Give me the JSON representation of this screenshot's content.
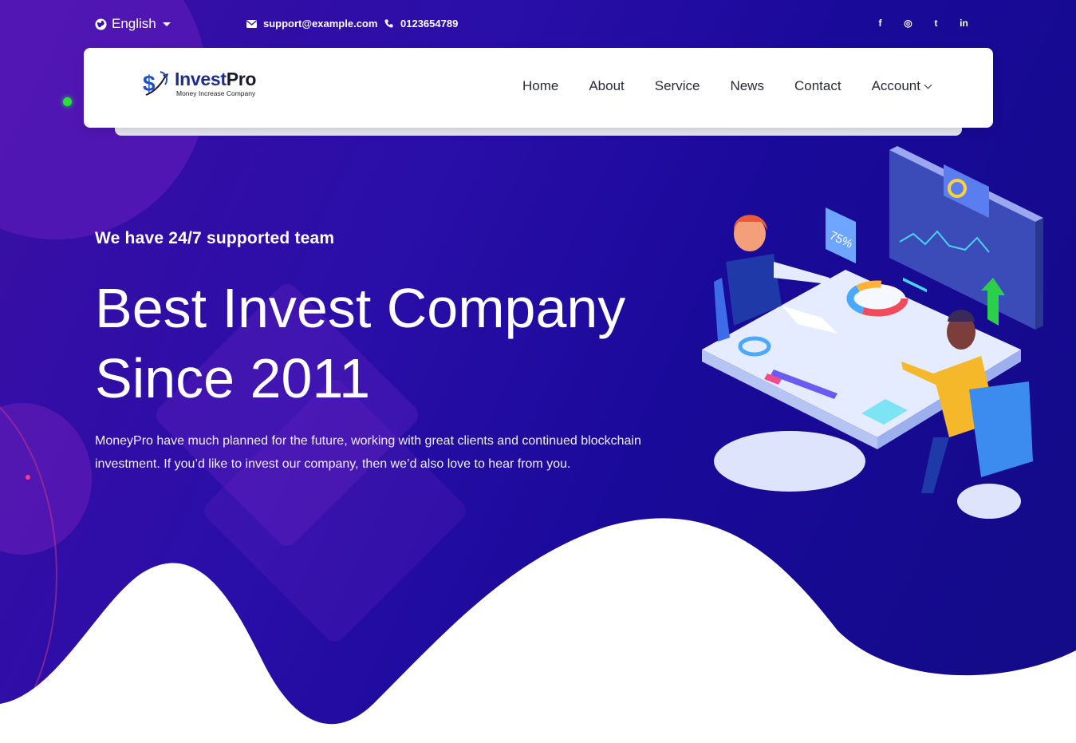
{
  "topbar": {
    "language": "English",
    "email": "support@example.com",
    "phone": "0123654789",
    "socials": [
      {
        "icon": "facebook-icon",
        "glyph": "f"
      },
      {
        "icon": "instagram-icon",
        "glyph": "◎"
      },
      {
        "icon": "twitter-icon",
        "glyph": "t"
      },
      {
        "icon": "linkedin-icon",
        "glyph": "in"
      }
    ]
  },
  "brand": {
    "name_part1": "Invest",
    "name_part2": "Pro",
    "tagline": "Money Increase Company"
  },
  "nav": {
    "items": [
      "Home",
      "About",
      "Service",
      "News",
      "Contact",
      "Account"
    ]
  },
  "hero": {
    "subtitle": "We have 24/7 supported team",
    "headline_line1": "Best Invest Company",
    "headline_line2": "Since 2011",
    "description": "MoneyPro have much planned for the future, working with great clients and continued blockchain investment. If you’d like to invest our company, then we’d also love to hear from you.",
    "badge_percent": "75%"
  },
  "colors": {
    "hero_bg": "#2a0ea8",
    "brand_blue": "#1f2d8a",
    "green_dot": "#27e03a"
  }
}
